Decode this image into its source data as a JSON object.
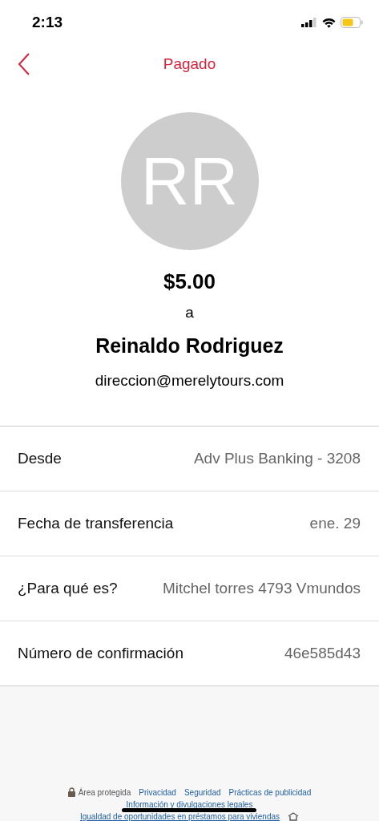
{
  "status_bar": {
    "time": "2:13"
  },
  "nav": {
    "title": "Pagado"
  },
  "recipient": {
    "initials": "RR",
    "amount": "$5.00",
    "connector": "a",
    "name": "Reinaldo Rodriguez",
    "email": "direccion@merelytours.com"
  },
  "details": [
    {
      "label": "Desde",
      "value": "Adv Plus Banking - 3208"
    },
    {
      "label": "Fecha de transferencia",
      "value": "ene. 29"
    },
    {
      "label": "¿Para qué es?",
      "value": "Mitchel torres 4793 Vmundos"
    },
    {
      "label": "Número de confirmación",
      "value": "46e585d43"
    }
  ],
  "footer": {
    "secure_label": "Área protegida",
    "links": [
      "Privacidad",
      "Seguridad",
      "Prácticas de publicidad"
    ],
    "legal_link": "Información y divulgaciones legales",
    "housing_link": "Igualdad de oportunidades en préstamos para viviendas"
  }
}
